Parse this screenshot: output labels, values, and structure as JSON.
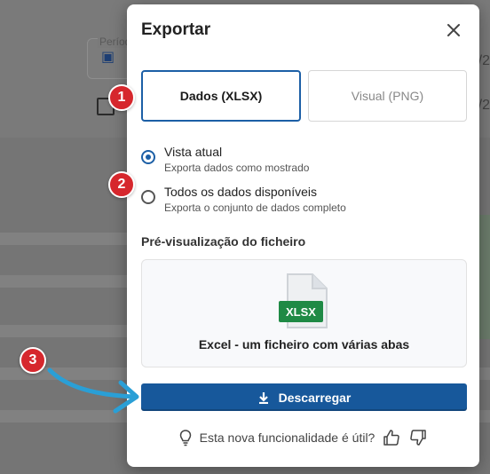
{
  "background": {
    "period_label": "Períod",
    "right_text": "/2"
  },
  "dialog": {
    "title": "Exportar",
    "tabs": [
      {
        "label": "Dados (XLSX)",
        "selected": true
      },
      {
        "label": "Visual (PNG)",
        "selected": false
      }
    ],
    "options": [
      {
        "label": "Vista atual",
        "description": "Exporta dados como mostrado",
        "selected": true
      },
      {
        "label": "Todos os dados disponíveis",
        "description": "Exporta o conjunto de dados completo",
        "selected": false
      }
    ],
    "preview_title": "Pré-visualização do ficheiro",
    "preview_badge": "XLSX",
    "preview_caption": "Excel - um ficheiro com várias abas",
    "download_label": "Descarregar",
    "feedback_text": "Esta nova funcionalidade é útil?"
  },
  "annotations": [
    "1",
    "2",
    "3"
  ],
  "colors": {
    "accent": "#1c5fa6",
    "button": "#17589b",
    "badge": "#d6272d",
    "arrow": "#2a9fd6",
    "xlsx_green": "#1f8a45"
  }
}
